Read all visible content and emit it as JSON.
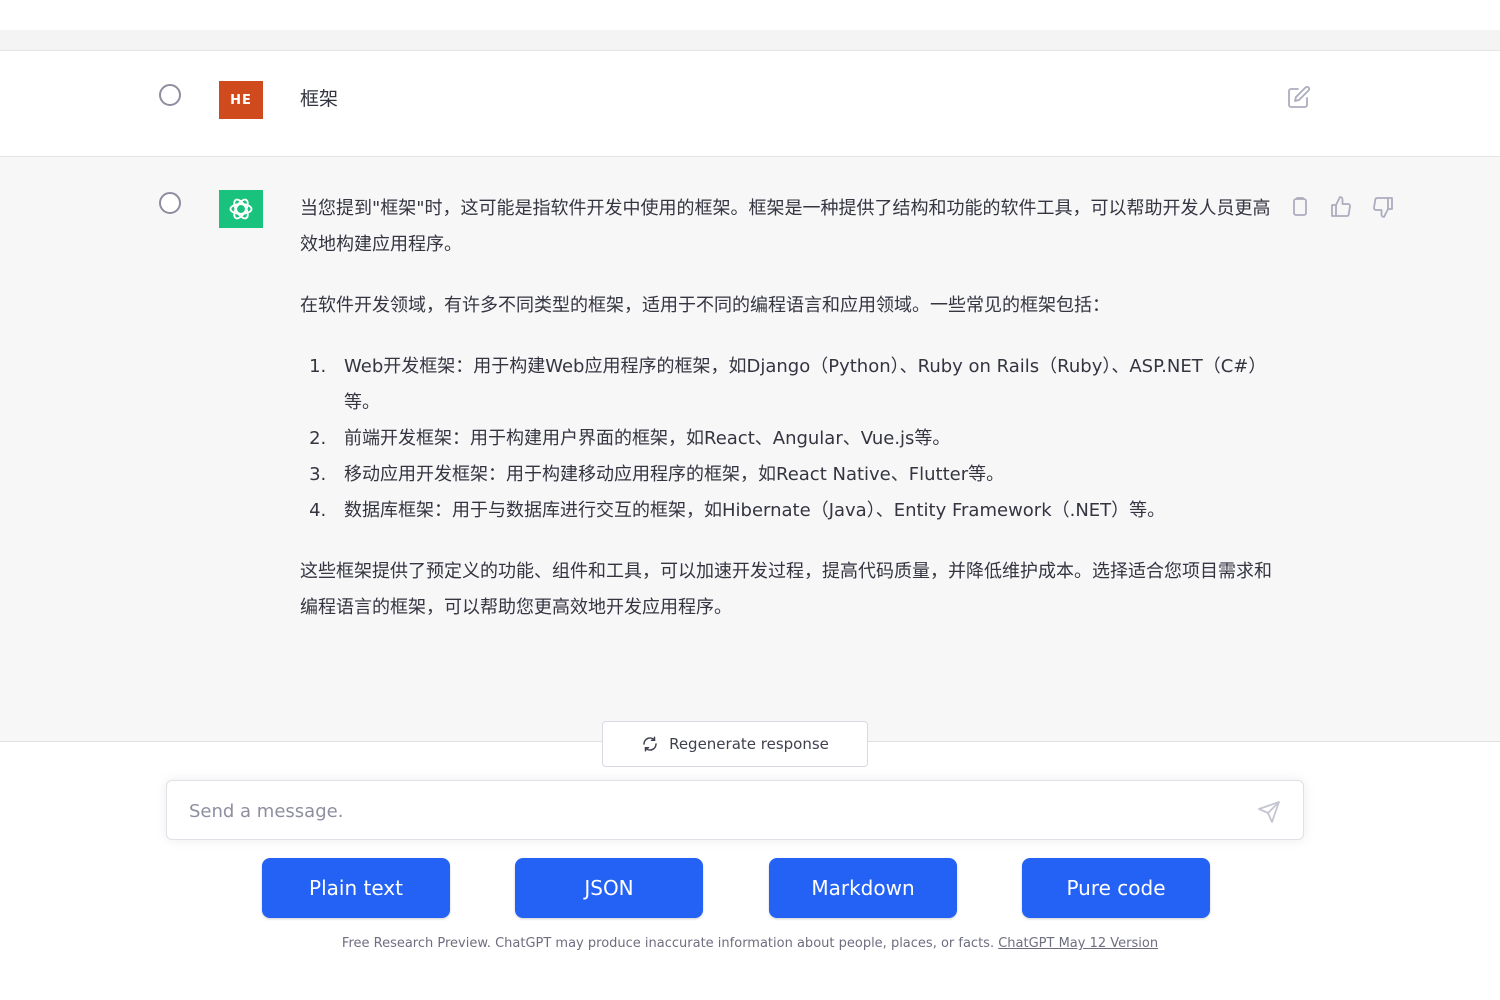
{
  "user_message": {
    "avatar_initials": "HE",
    "avatar_color": "#cf4a1c",
    "text": "框架",
    "edit_icon": "edit-icon"
  },
  "assistant_message": {
    "avatar_icon": "openai-logo-icon",
    "avatar_color": "#19c37d",
    "intro": "当您提到\"框架\"时，这可能是指软件开发中使用的框架。框架是一种提供了结构和功能的软件工具，可以帮助开发人员更高效地构建应用程序。",
    "para2": "在软件开发领域，有许多不同类型的框架，适用于不同的编程语言和应用领域。一些常见的框架包括：",
    "list": [
      "Web开发框架：用于构建Web应用程序的框架，如Django（Python）、Ruby on Rails（Ruby）、ASP.NET（C#）等。",
      "前端开发框架：用于构建用户界面的框架，如React、Angular、Vue.js等。",
      "移动应用开发框架：用于构建移动应用程序的框架，如React Native、Flutter等。",
      "数据库框架：用于与数据库进行交互的框架，如Hibernate（Java）、Entity Framework（.NET）等。"
    ],
    "conclusion": "这些框架提供了预定义的功能、组件和工具，可以加速开发过程，提高代码质量，并降低维护成本。选择适合您项目需求和编程语言的框架，可以帮助您更高效地开发应用程序。",
    "actions": [
      "copy-icon",
      "thumbs-up-icon",
      "thumbs-down-icon"
    ]
  },
  "regenerate": {
    "label": "Regenerate response",
    "icon": "refresh-icon"
  },
  "composer": {
    "placeholder": "Send a message.",
    "value": "",
    "send_icon": "send-icon"
  },
  "format_buttons": [
    "Plain text",
    "JSON",
    "Markdown",
    "Pure code"
  ],
  "footer": {
    "text": "Free Research Preview. ChatGPT may produce inaccurate information about people, places, or facts.",
    "link": "ChatGPT May 12 Version"
  },
  "colors": {
    "accent": "#2462f5",
    "assistant_bg": "#f7f7f8"
  }
}
